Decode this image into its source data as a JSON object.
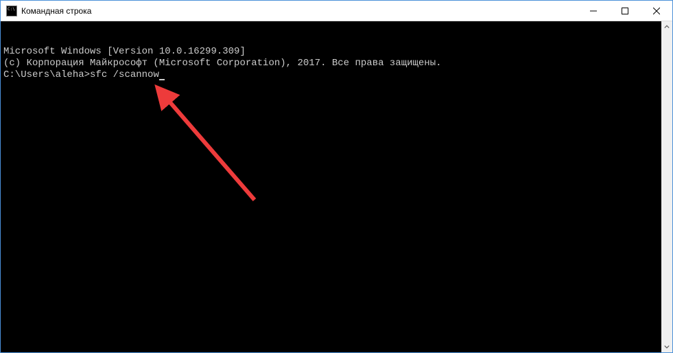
{
  "window": {
    "title": "Командная строка"
  },
  "console": {
    "line1": "Microsoft Windows [Version 10.0.16299.309]",
    "line2": "(c) Корпорация Майкрософт (Microsoft Corporation), 2017. Все права защищены.",
    "blank": "",
    "prompt": "C:\\Users\\aleha>",
    "command": "sfc /scannow"
  },
  "annotation": {
    "arrow_color": "#ed3b3b"
  }
}
